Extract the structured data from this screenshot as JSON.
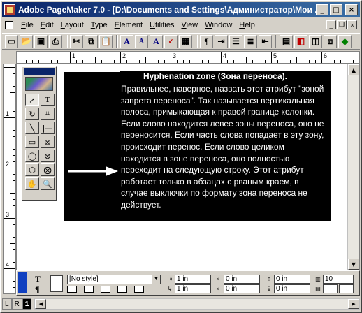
{
  "window": {
    "title": "Adobe PageMaker 7.0 - [D:\\Documents and Settings\\Администратор\\Мои ...",
    "minimize": "_",
    "maximize": "□",
    "close": "×"
  },
  "menubar": {
    "items": [
      "File",
      "Edit",
      "Layout",
      "Type",
      "Element",
      "Utilities",
      "View",
      "Window",
      "Help"
    ]
  },
  "callout": {
    "title": "Hyphenation zone (Зона переноса).",
    "body": "Правильнее, наверное, назвать этот атрибут \"зоной запрета переноса\". Так называется вертикальная полоса, примыкающая к правой границе колонки. Если слово находится левее зоны переноса, оно не переносится. Если часть слова попадает в эту зону, происходит перенос. Если слово целиком находится в зоне переноса, оно полностью переходит на следующую строку. Этот атрибут работает только в абзацах с рваным краем, в случае выключки по формату зона переноса не действует."
  },
  "control_palette": {
    "style": "[No style]",
    "left_indent": "1 in",
    "first_indent": "1 in",
    "right_indent": "0 in",
    "right_indent2": "0 in",
    "space_before": "0 in",
    "space_after": "0 in",
    "grid": "10"
  },
  "ruler": {
    "top_labels": [
      "1",
      "2",
      "3",
      "4",
      "5",
      "6",
      "7"
    ],
    "left_labels": [
      "1",
      "2",
      "3",
      "4",
      "5"
    ]
  },
  "status": {
    "page_L": "L",
    "page_R": "R",
    "page_current": "1"
  }
}
